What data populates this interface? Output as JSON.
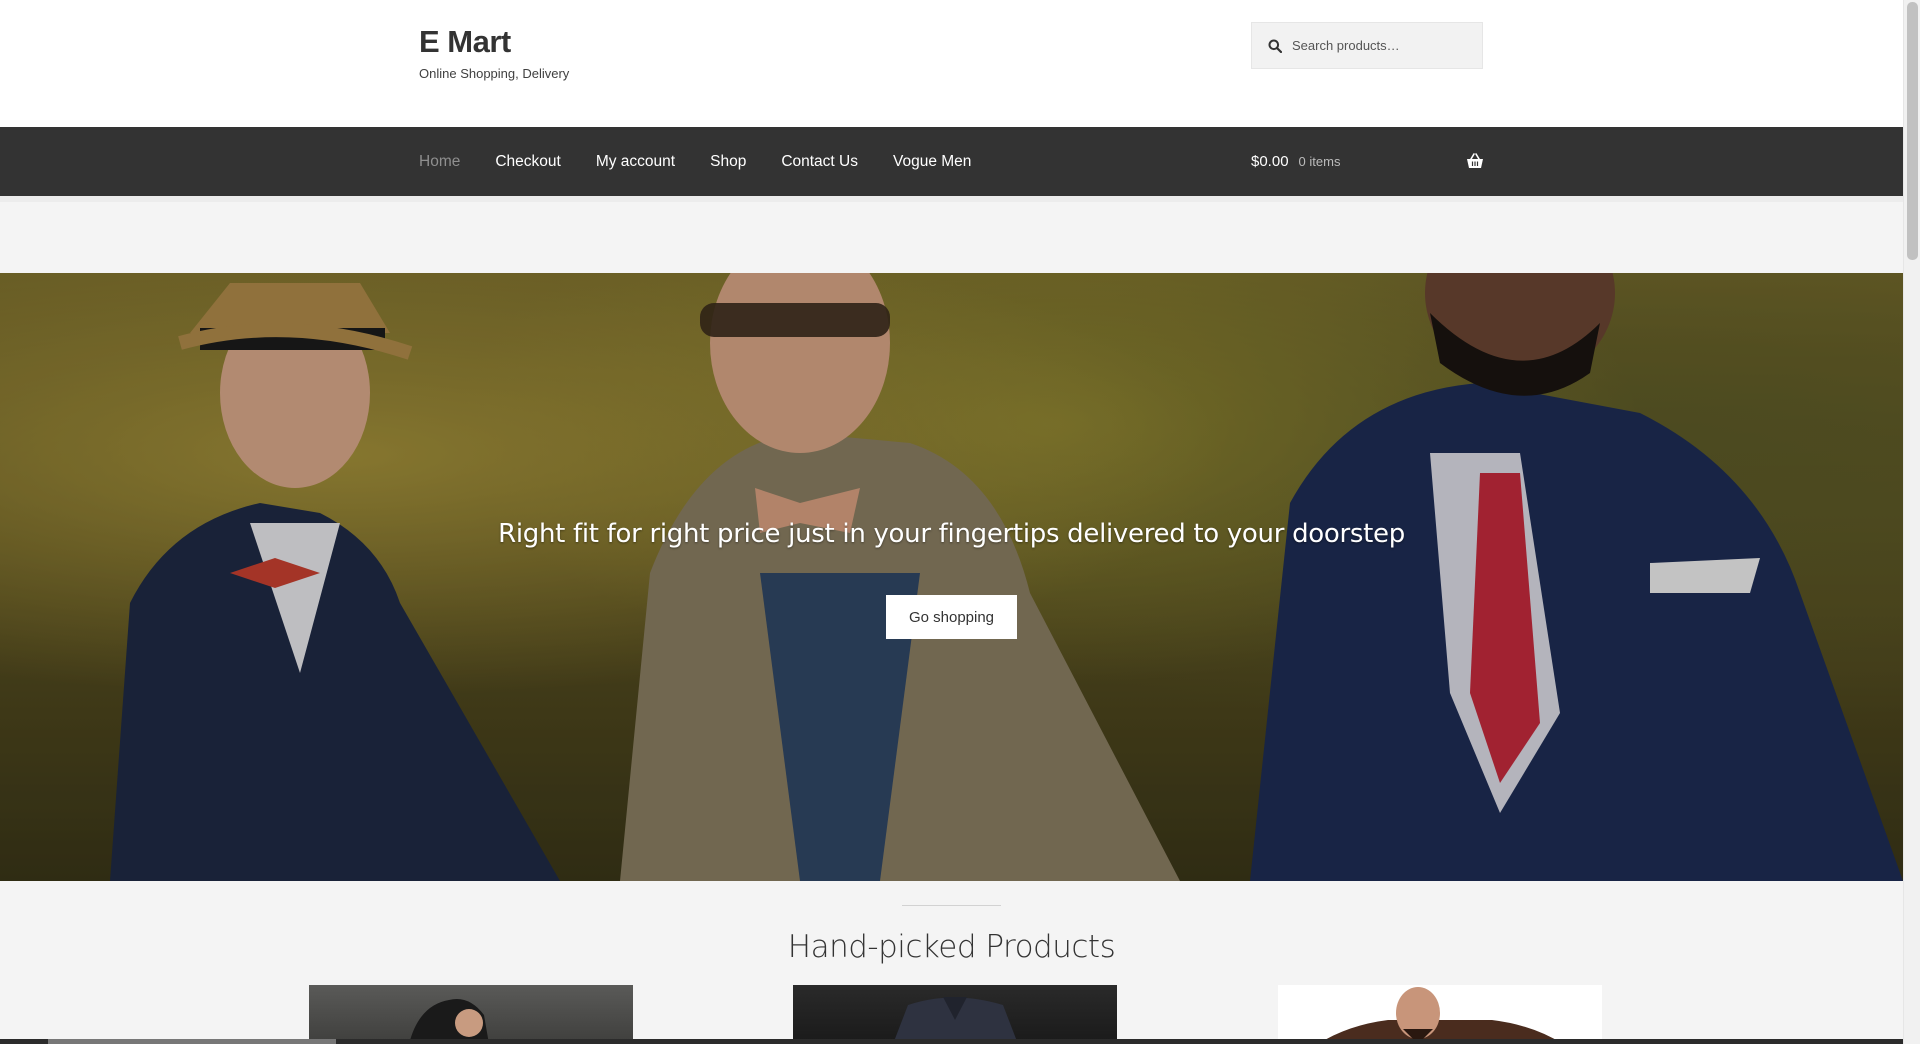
{
  "header": {
    "site_title": "E Mart",
    "tagline": "Online Shopping, Delivery",
    "search_placeholder": "Search products…"
  },
  "nav": {
    "items": [
      {
        "label": "Home",
        "active": true
      },
      {
        "label": "Checkout",
        "active": false
      },
      {
        "label": "My account",
        "active": false
      },
      {
        "label": "Shop",
        "active": false
      },
      {
        "label": "Contact Us",
        "active": false
      },
      {
        "label": "Vogue Men",
        "active": false
      }
    ]
  },
  "cart": {
    "amount": "$0.00",
    "count": "0 items",
    "icon": "basket-icon"
  },
  "hero": {
    "heading": "Right fit for right price just in your fingertips delivered to your doorstep",
    "button_label": "Go shopping"
  },
  "products": {
    "section_title": "Hand-picked Products"
  },
  "colors": {
    "nav_bg": "#333333",
    "nav_active": "#8f8f8f",
    "page_bg": "#f4f4f4"
  }
}
